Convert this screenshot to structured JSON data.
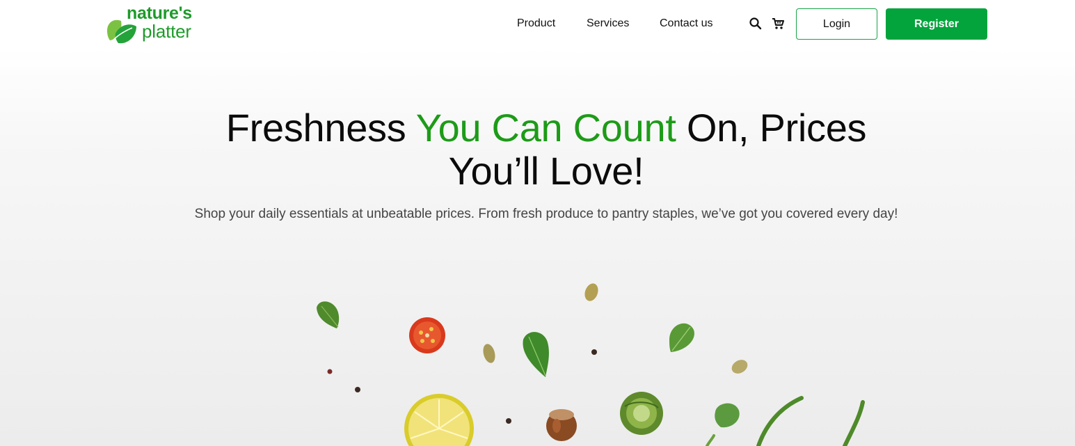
{
  "brand": {
    "line1": "nature's",
    "line2": "platter",
    "color": "#1d9b2a"
  },
  "nav": {
    "links": [
      "Product",
      "Services",
      "Contact us"
    ],
    "icons": [
      "search-icon",
      "cart-icon"
    ],
    "login_label": "Login",
    "register_label": "Register",
    "accent_color": "#04a43c"
  },
  "hero": {
    "title_part1": "Freshness ",
    "title_accent": "You Can Count",
    "title_part2": " On, Prices You’ll Love!",
    "subtitle": "Shop your daily essentials at unbeatable prices. From fresh produce to pantry staples, we’ve got you covered every day!",
    "accent_color": "#1d9b18"
  }
}
